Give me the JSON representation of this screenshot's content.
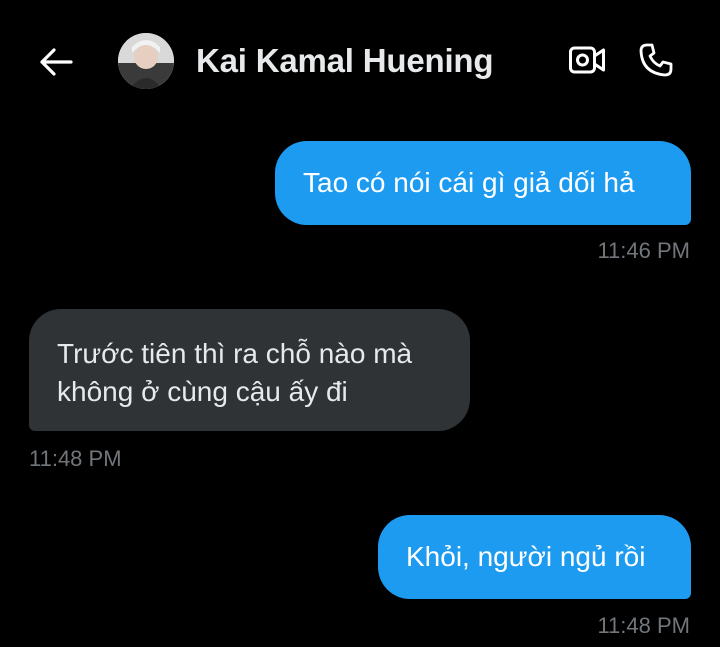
{
  "header": {
    "contact_name": "Kai Kamal Huening",
    "back_icon": "arrow-left-icon",
    "video_icon": "video-camera-icon",
    "call_icon": "phone-icon"
  },
  "messages": [
    {
      "direction": "sent",
      "text": "Tao có nói cái gì giả dối hả",
      "time": "11:46 PM"
    },
    {
      "direction": "received",
      "text": "Trước tiên thì ra chỗ nào mà không ở cùng cậu ấy đi",
      "time": "11:48 PM"
    },
    {
      "direction": "sent",
      "text": "Khỏi, người ngủ rồi",
      "time": "11:48 PM"
    }
  ],
  "colors": {
    "background": "#000000",
    "sent_bubble": "#1d9bf0",
    "received_bubble": "#2f3336",
    "timestamp": "#71767b",
    "text": "#e7e9ea"
  }
}
